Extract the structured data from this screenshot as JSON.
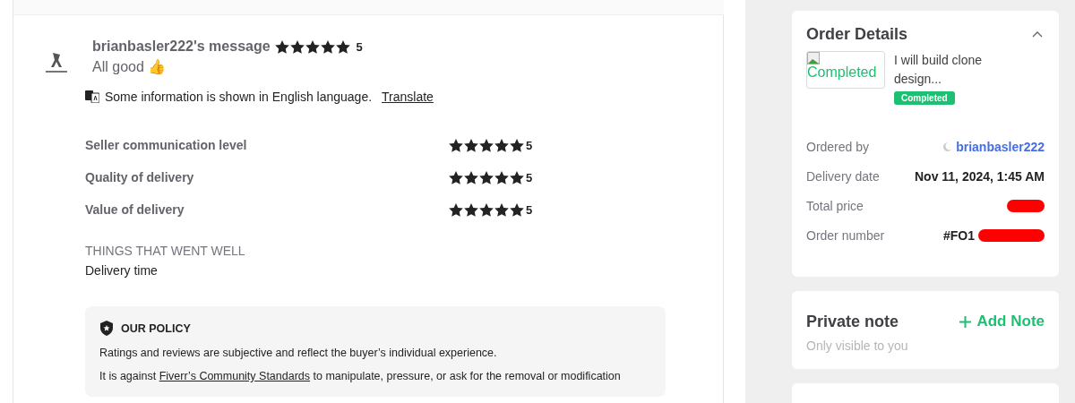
{
  "review": {
    "author": "brianbasler222's message",
    "stars": 5,
    "score": "5",
    "message": "All good 👍",
    "translation": {
      "notice": "Some information is shown in English language.",
      "link": "Translate"
    },
    "ratings": [
      {
        "label": "Seller communication level",
        "stars": 5,
        "score": "5"
      },
      {
        "label": "Quality of delivery",
        "stars": 5,
        "score": "5"
      },
      {
        "label": "Value of delivery",
        "stars": 5,
        "score": "5"
      }
    ],
    "went_well": {
      "heading": "THINGS THAT WENT WELL",
      "items": [
        "Delivery time"
      ]
    },
    "policy": {
      "title": "OUR POLICY",
      "text": "Ratings and reviews are subjective and reflect the buyer’s individual experience.",
      "text2_before": "It is against ",
      "text2_link": "Fiverr’s Community Standards",
      "text2_after": " to manipulate, pressure, or ask for the removal or modification"
    }
  },
  "order_details": {
    "title": "Order Details",
    "expanded": true,
    "image_alt": "Completed",
    "gig_title": "I will build clone design...",
    "status": "Completed",
    "rows": [
      {
        "label": "Ordered by",
        "value": "brianbasler222",
        "kind": "user"
      },
      {
        "label": "Delivery date",
        "value": "Nov 11, 2024, 1:45 AM",
        "kind": "text"
      },
      {
        "label": "Total price",
        "value": "",
        "kind": "redacted"
      },
      {
        "label": "Order number",
        "value": "#FO1",
        "kind": "redacted"
      }
    ]
  },
  "private_note": {
    "title": "Private note",
    "subtitle": "Only visible to you",
    "action": "Add Note"
  }
}
